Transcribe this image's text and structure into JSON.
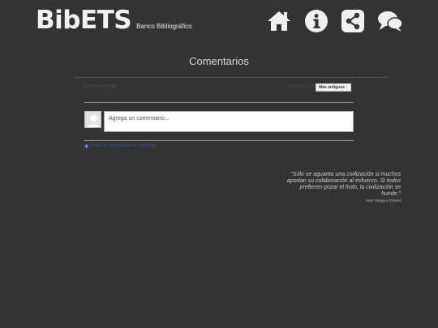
{
  "header": {
    "logo_text": "BibETS",
    "logo_sub": "Banco Bibliográfico",
    "nav": [
      {
        "icon": "home-icon"
      },
      {
        "icon": "info-icon"
      },
      {
        "icon": "share-icon"
      },
      {
        "icon": "chat-icon"
      }
    ]
  },
  "main": {
    "title": "Comentarios",
    "comments": {
      "count_label": "0 comentarios",
      "sort_label": "Ordenar por",
      "sort_value": "Más antiguos ↑",
      "input_placeholder": "Agrega un comentario...",
      "plugin_label": "Plugin de comentarios de Facebook"
    }
  },
  "quote": {
    "text": "\"Sólo se aguanta una civilización si muchos aportan su colaboración al esfuerzo. Si todos prefieren gozar el fruto, la civilización se hunde.\"",
    "author": "José Ortega y Gasset"
  },
  "colors": {
    "background": "#333333",
    "facebook": "#3b5998"
  }
}
